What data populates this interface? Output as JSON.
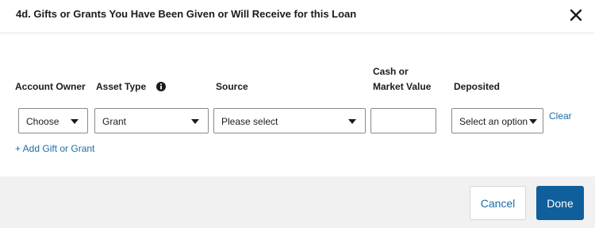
{
  "dialog": {
    "title": "4d. Gifts or Grants You Have Been Given or Will Receive for this Loan"
  },
  "columns": {
    "account_owner": "Account Owner",
    "asset_type": "Asset Type",
    "source": "Source",
    "cash_line1": "Cash or",
    "cash_line2": "Market Value",
    "deposited": "Deposited"
  },
  "row": {
    "account_owner_value": "Choose",
    "asset_type_value": "Grant",
    "source_value": "Please select",
    "cash_value": "",
    "deposited_value": "Select an option",
    "clear_label": "Clear"
  },
  "add_link_label": "+ Add Gift or Grant",
  "footer": {
    "cancel_label": "Cancel",
    "done_label": "Done"
  },
  "colors": {
    "link": "#1a6ea6",
    "primary_button": "#0f5f9c",
    "footer_bg": "#f1f1f1"
  },
  "icons": [
    "close-icon",
    "info-icon",
    "chevron-down-icon"
  ]
}
